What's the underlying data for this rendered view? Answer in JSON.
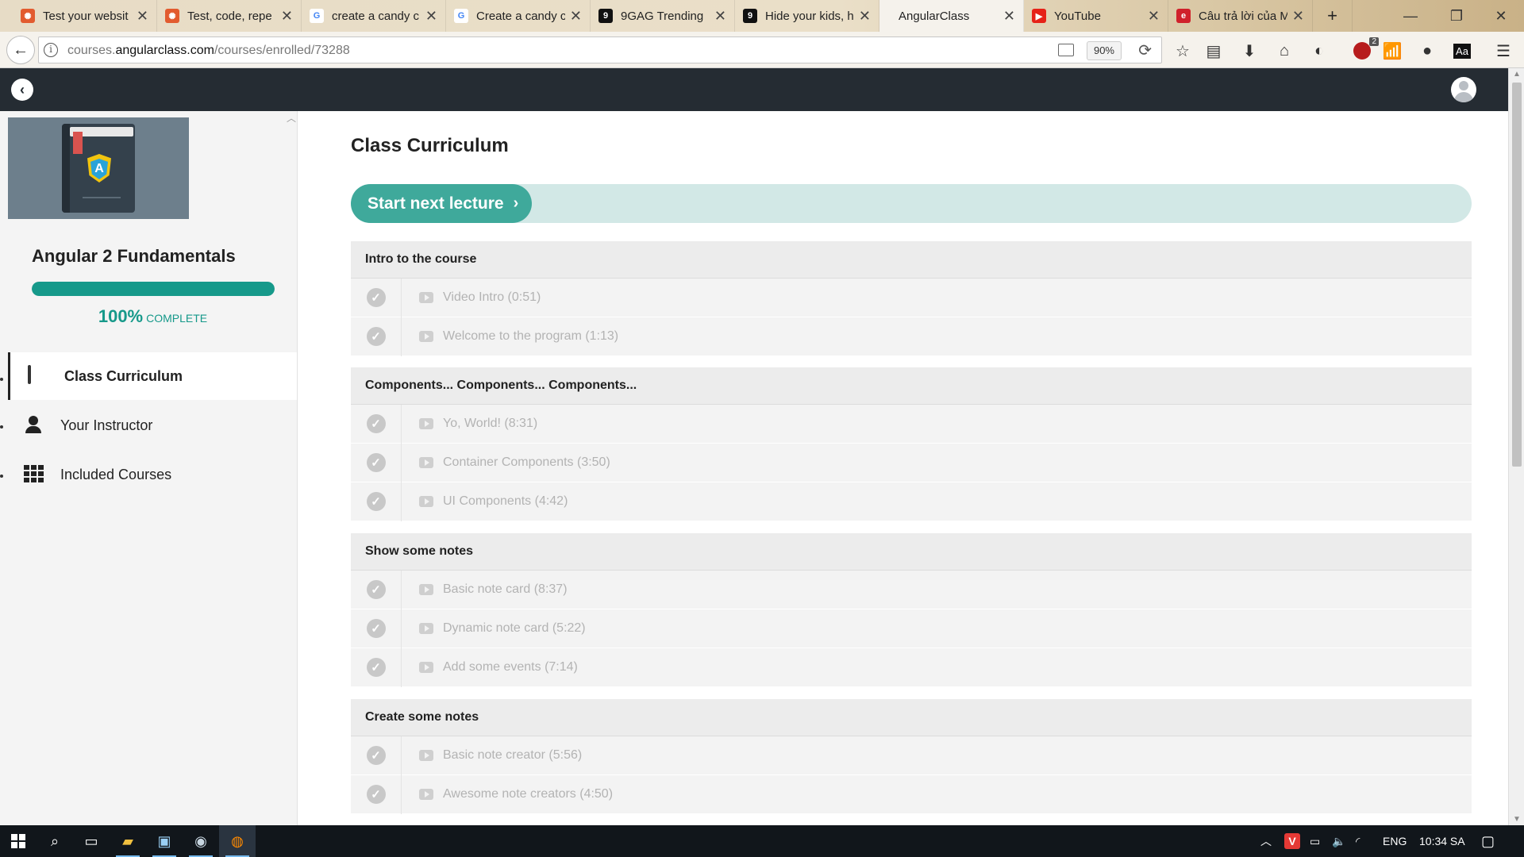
{
  "browser": {
    "tabs": [
      {
        "title": "Test your websit",
        "fav": "codepen-icon",
        "color": "#e25b2f"
      },
      {
        "title": "Test, code, repe",
        "fav": "codepen-icon",
        "color": "#e25b2f"
      },
      {
        "title": "create a candy c",
        "fav": "google-icon",
        "color": "#4285f4"
      },
      {
        "title": "Create a candy c",
        "fav": "google-icon",
        "color": "#4285f4"
      },
      {
        "title": "9GAG Trending",
        "fav": "9gag-icon",
        "color": "#111111"
      },
      {
        "title": "Hide your kids, h",
        "fav": "9gag-icon",
        "color": "#111111"
      },
      {
        "title": "AngularClass",
        "fav": "none",
        "color": "#f5f2ec"
      },
      {
        "title": "YouTube",
        "fav": "youtube-icon",
        "color": "#e62117"
      },
      {
        "title": "Câu trả lời của M",
        "fav": "site-icon",
        "color": "#d0212b"
      }
    ],
    "url_prefix": "courses.",
    "url_domain": "angularclass.com",
    "url_path": "/courses/enrolled/73288",
    "zoom": "90%",
    "ublock_badge": "2",
    "aa_label": "Aa"
  },
  "sidebar": {
    "course_title": "Angular 2 Fundamentals",
    "progress_percent": 100,
    "progress_label": "100%",
    "complete_label": "COMPLETE",
    "items": [
      {
        "label": "Class Curriculum",
        "icon": "list-icon"
      },
      {
        "label": "Your Instructor",
        "icon": "user-icon"
      },
      {
        "label": "Included Courses",
        "icon": "grid-icon"
      }
    ]
  },
  "main": {
    "title": "Class Curriculum",
    "cta_label": "Start next lecture",
    "sections": [
      {
        "title": "Intro to the course",
        "lectures": [
          "Video Intro (0:51)",
          "Welcome to the program (1:13)"
        ]
      },
      {
        "title": "Components... Components... Components...",
        "lectures": [
          "Yo, World! (8:31)",
          "Container Components (3:50)",
          "UI Components (4:42)"
        ]
      },
      {
        "title": "Show some notes",
        "lectures": [
          "Basic note card (8:37)",
          "Dynamic note card (5:22)",
          "Add some events (7:14)"
        ]
      },
      {
        "title": "Create some notes",
        "lectures": [
          "Basic note creator (5:56)",
          "Awesome note creators (4:50)"
        ]
      }
    ]
  },
  "taskbar": {
    "lang": "ENG",
    "time": "10:34 SA"
  },
  "colors": {
    "accent": "#16998a",
    "cta": "#3fa99b",
    "cta_track": "#d2e8e6",
    "header": "#252c33"
  }
}
